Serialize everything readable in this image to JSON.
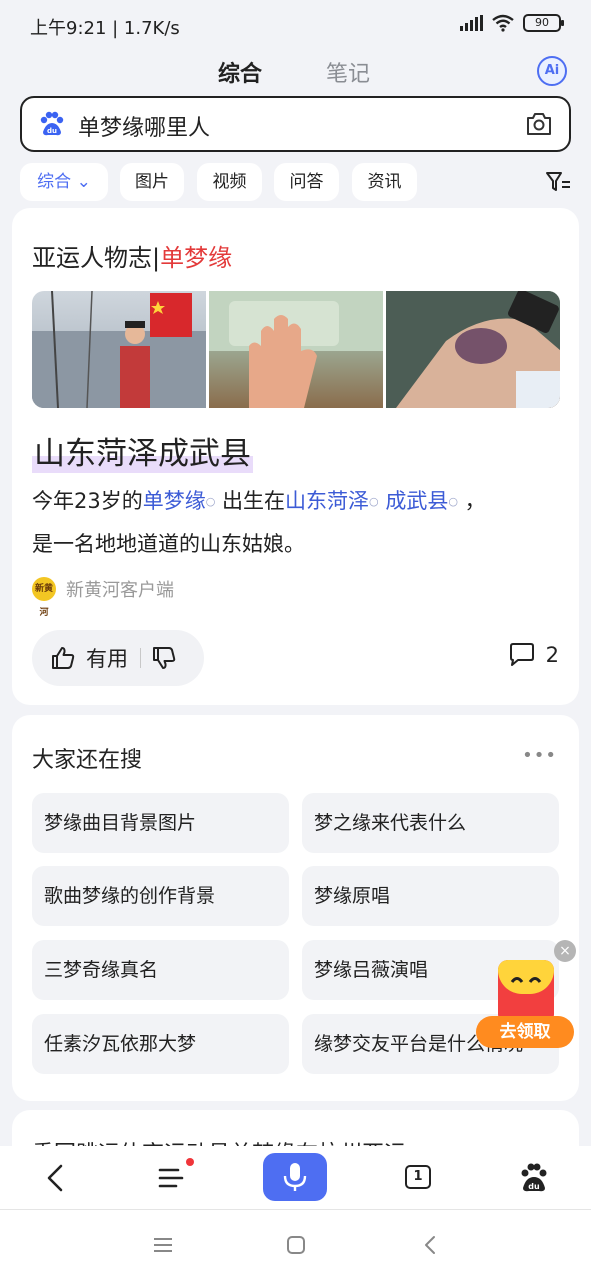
{
  "status_bar": {
    "time": "上午9:21 | 1.7K/s",
    "battery": "90"
  },
  "top_tabs": [
    {
      "label": "综合"
    },
    {
      "label": "笔记"
    }
  ],
  "ai_button": "Ai",
  "search": {
    "query": "单梦缘哪里人"
  },
  "filters": [
    "综合",
    "图片",
    "视频",
    "问答",
    "资讯"
  ],
  "answer_card": {
    "title_prefix": "亚运人物志|",
    "title_highlight": "单梦缘",
    "answer": "山东菏泽成武县",
    "para": {
      "t1": "今年23岁的",
      "l1": "单梦缘",
      "t2": " 出生在",
      "l2": "山东菏泽",
      "t3": " ",
      "l3": "成武县",
      "t4": " ，",
      "line2": "是一名地地道道的山东姑娘。"
    },
    "source": "新黄河客户端",
    "source_logo_text": "新黄河",
    "useful_label": "有用",
    "comment_count": "2"
  },
  "related": {
    "title": "大家还在搜",
    "more": "•••",
    "items": [
      "梦缘曲目背景图片",
      "梦之缘来代表什么",
      "歌曲梦缘的创作背景",
      "梦缘原唱",
      "三梦奇缘真名",
      "梦缘吕薇演唱",
      "任素汐瓦依那大梦",
      "缘梦交友平台是什么情况"
    ]
  },
  "next_card": {
    "text": "重回跳远体育运动员单梦缘在杭州亚运"
  },
  "promo": {
    "label": "去领取"
  },
  "bottom_nav": {
    "tab_count": "1"
  },
  "colors": {
    "accent": "#4e6ef2",
    "highlight_red": "#e33a3a",
    "link": "#3c5bd6"
  }
}
